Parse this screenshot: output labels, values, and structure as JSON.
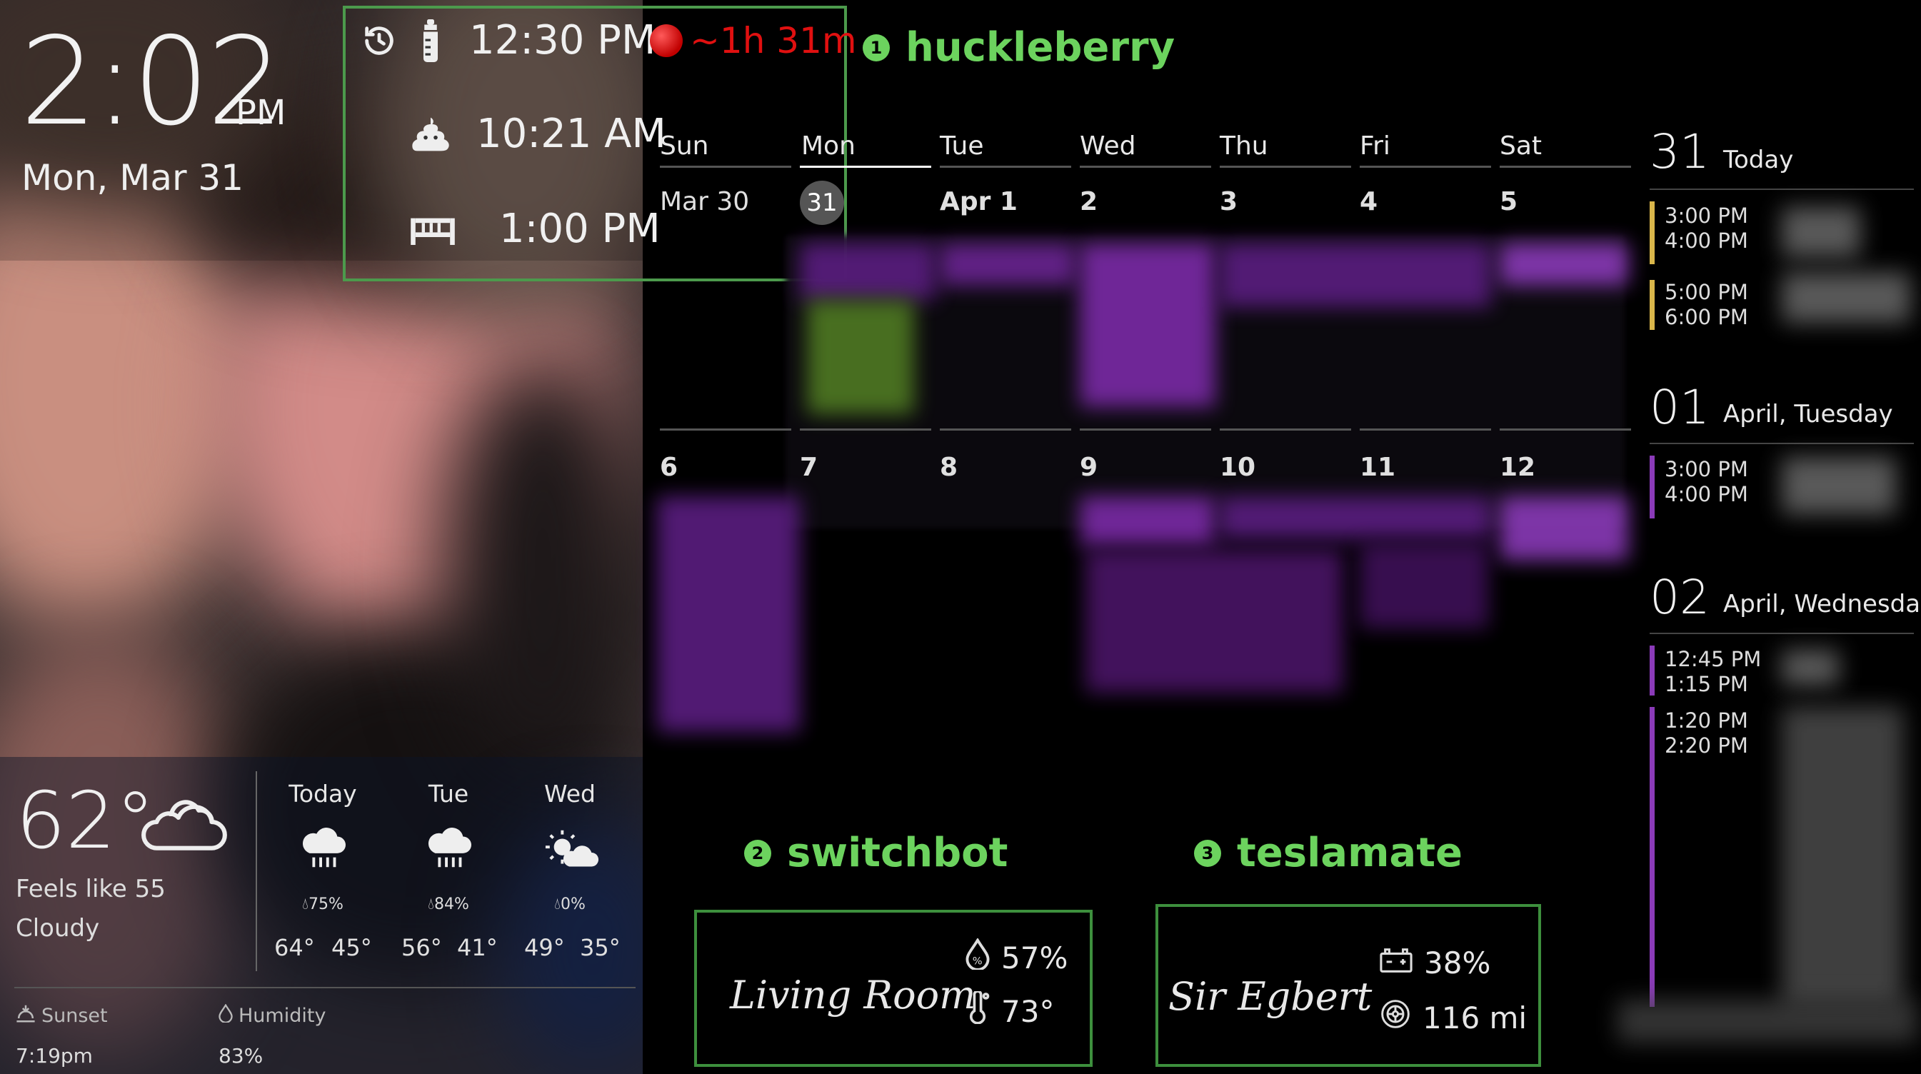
{
  "clock": {
    "time": "2:02",
    "ampm": "PM",
    "date": "Mon, Mar 31"
  },
  "tracker": {
    "rows": [
      {
        "icon": "history-bottle-icon",
        "time": "12:30 PM"
      },
      {
        "icon": "poop-icon",
        "time": "10:21 AM"
      },
      {
        "icon": "sleep-icon",
        "time": "1:00 PM"
      }
    ],
    "next_feed": "~1h 31m",
    "alert_color": "#e01010"
  },
  "sections": {
    "huckleberry": {
      "num": "1",
      "title": "huckleberry"
    },
    "switchbot": {
      "num": "2",
      "title": "switchbot"
    },
    "teslamate": {
      "num": "3",
      "title": "teslamate"
    }
  },
  "calendar": {
    "day_names": [
      "Sun",
      "Mon",
      "Tue",
      "Wed",
      "Thu",
      "Fri",
      "Sat"
    ],
    "week1": [
      "Mar 30",
      "31",
      "Apr 1",
      "2",
      "3",
      "4",
      "5"
    ],
    "week2": [
      "6",
      "7",
      "8",
      "9",
      "10",
      "11",
      "12"
    ],
    "today_index": 1
  },
  "agenda": {
    "days": [
      {
        "num": "31",
        "label": "Today",
        "events": [
          {
            "start": "3:00 PM",
            "end": "4:00 PM",
            "color": "#d9b64a"
          },
          {
            "start": "5:00 PM",
            "end": "6:00 PM",
            "color": "#d9b64a"
          }
        ]
      },
      {
        "num": "01",
        "label": "April, Tuesday",
        "events": [
          {
            "start": "3:00 PM",
            "end": "4:00 PM",
            "color": "#8a3ab8"
          }
        ]
      },
      {
        "num": "02",
        "label": "April, Wednesda",
        "events": [
          {
            "start": "12:45 PM",
            "end": "1:15 PM",
            "color": "#8a3ab8"
          },
          {
            "start": "1:20 PM",
            "end": "2:20 PM",
            "color": "#8a3ab8"
          }
        ]
      }
    ]
  },
  "weather": {
    "temp": "62°",
    "condition_icon": "cloudy-icon",
    "feels_like": "Feels like 55",
    "condition": "Cloudy",
    "forecast": [
      {
        "day": "Today",
        "icon": "rain-icon",
        "pop": "75%",
        "hi": "64°",
        "lo": "45°"
      },
      {
        "day": "Tue",
        "icon": "rain-icon",
        "pop": "84%",
        "hi": "56°",
        "lo": "41°"
      },
      {
        "day": "Wed",
        "icon": "partly-cloudy-icon",
        "pop": "0%",
        "hi": "49°",
        "lo": "35°"
      }
    ],
    "sunset_label": "Sunset",
    "sunset_value": "7:19pm",
    "humidity_label": "Humidity",
    "humidity_value": "83%"
  },
  "switchbot": {
    "name": "Living Room",
    "humidity": "57%",
    "temperature": "73°"
  },
  "teslamate": {
    "name": "Sir Egbert",
    "battery": "38%",
    "range": "116 mi"
  }
}
